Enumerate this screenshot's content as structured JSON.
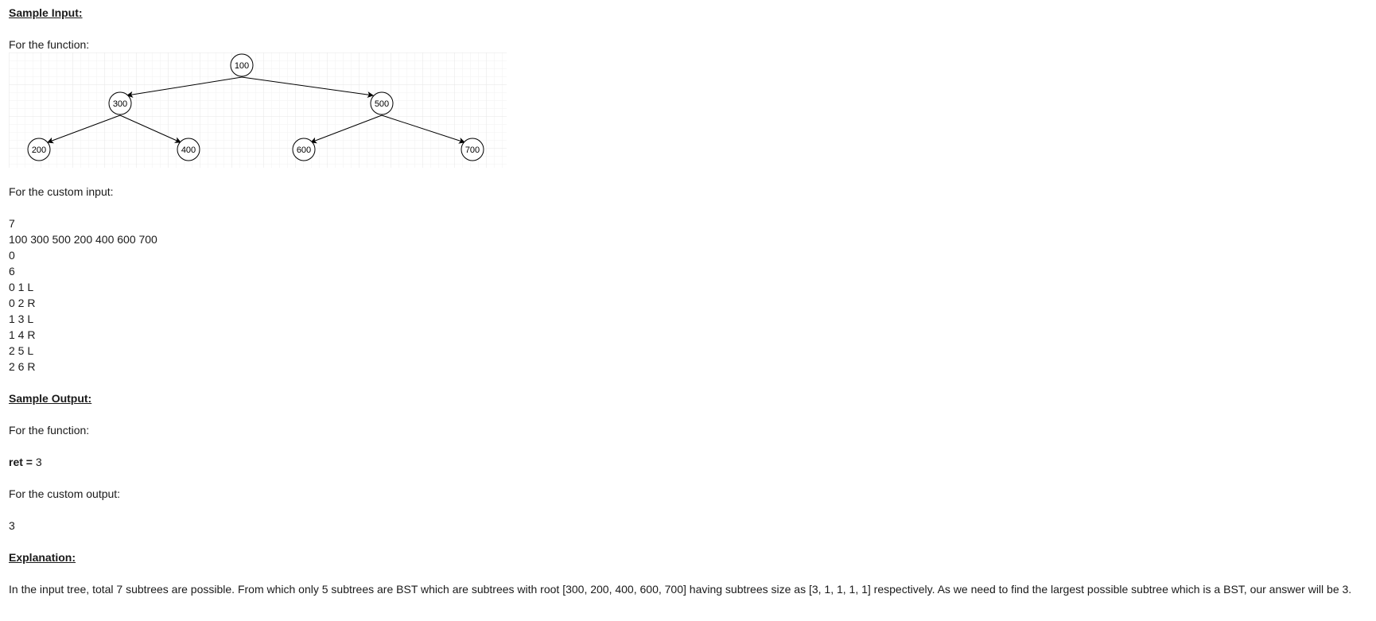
{
  "sample_input": {
    "heading": "Sample Input:",
    "function_label": "For the function:",
    "custom_label": "For the custom input:",
    "custom_lines": [
      "7",
      "100 300 500 200 400 600 700",
      "0",
      "6",
      "0 1 L",
      "0 2 R",
      "1 3 L",
      "1 4 R",
      "2 5 L",
      "2 6 R"
    ]
  },
  "tree": {
    "nodes": [
      "100",
      "300",
      "500",
      "200",
      "400",
      "600",
      "700"
    ]
  },
  "sample_output": {
    "heading": "Sample Output:",
    "function_label": "For the function:",
    "ret_label": "ret =",
    "ret_value": "3",
    "custom_label": "For the custom output:",
    "custom_value": "3"
  },
  "explanation": {
    "heading": "Explanation:",
    "text": "In the input tree, total 7 subtrees are possible. From which only 5 subtrees are BST which are subtrees with root [300, 200, 400, 600, 700] having subtrees size as [3, 1, 1, 1, 1] respectively. As we need to find the largest possible subtree which is a BST, our answer will be 3."
  }
}
